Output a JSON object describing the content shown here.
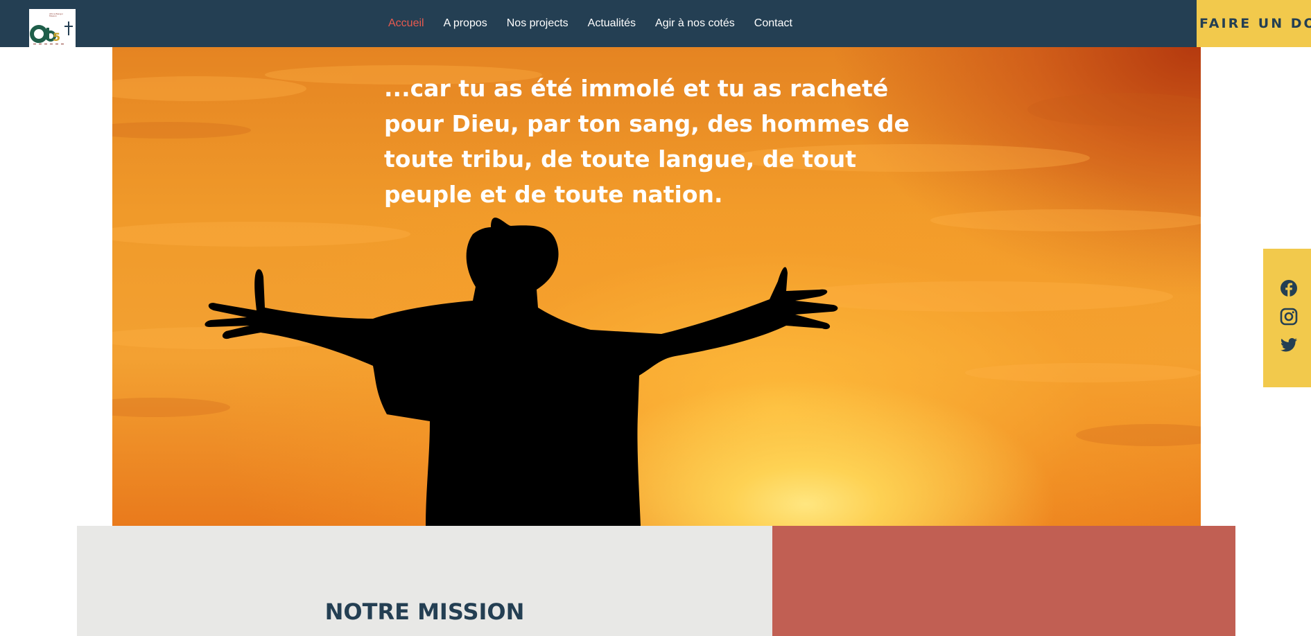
{
  "header": {
    "logo": {
      "letters": "Ob5",
      "tagline": "Africa Bangui Mission"
    },
    "nav": [
      {
        "label": "Accueil",
        "active": true
      },
      {
        "label": "A propos",
        "active": false
      },
      {
        "label": "Nos projects",
        "active": false
      },
      {
        "label": "Actualités",
        "active": false
      },
      {
        "label": "Agir à nos cotés",
        "active": false
      },
      {
        "label": "Contact",
        "active": false
      }
    ],
    "donate_label": "FAIRE UN DON"
  },
  "hero": {
    "quote": "...car tu as été immolé et tu as racheté pour Dieu, par ton sang, des hommes de toute tribu, de toute langue, de tout peuple et de toute nation."
  },
  "social": {
    "icons": [
      "facebook-icon",
      "instagram-icon",
      "twitter-icon"
    ]
  },
  "mission": {
    "title": "NOTRE MISSION"
  },
  "colors": {
    "navy": "#243f53",
    "accent_red": "#e85a4f",
    "yellow": "#f2c94c",
    "brick": "#c15f53",
    "light_gray": "#e8e8e6"
  }
}
